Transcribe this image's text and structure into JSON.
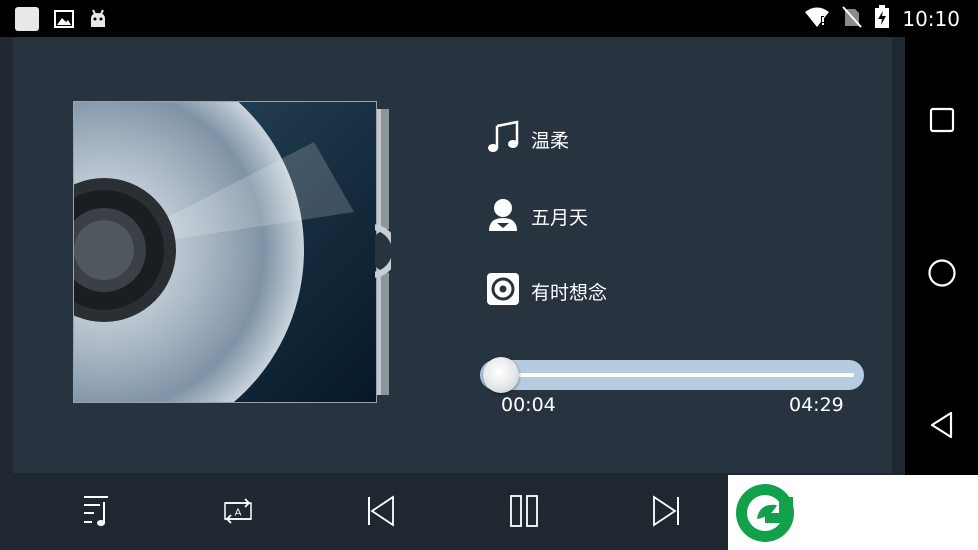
{
  "status_bar": {
    "time": "10:10",
    "left_icons": [
      "app-square-icon",
      "image-icon",
      "android-icon"
    ],
    "right_icons": [
      "wifi-icon",
      "no-sim-icon",
      "battery-charging-icon"
    ]
  },
  "track": {
    "title": "温柔",
    "artist": "五月天",
    "album": "有时想念"
  },
  "progress": {
    "elapsed": "00:04",
    "duration": "04:29",
    "fraction": 0.015
  },
  "controls": [
    {
      "name": "playlist-button",
      "icon": "playlist-music-icon"
    },
    {
      "name": "repeat-mode-button",
      "icon": "repeat-a-icon"
    },
    {
      "name": "previous-button",
      "icon": "skip-previous-icon"
    },
    {
      "name": "pause-button",
      "icon": "pause-icon"
    },
    {
      "name": "next-button",
      "icon": "skip-next-icon"
    }
  ],
  "nav": [
    "recents-icon",
    "home-icon",
    "back-icon"
  ],
  "colors": {
    "panel": "#283340",
    "progress_track": "#b7cbe0",
    "logo_green": "#13a04b"
  }
}
